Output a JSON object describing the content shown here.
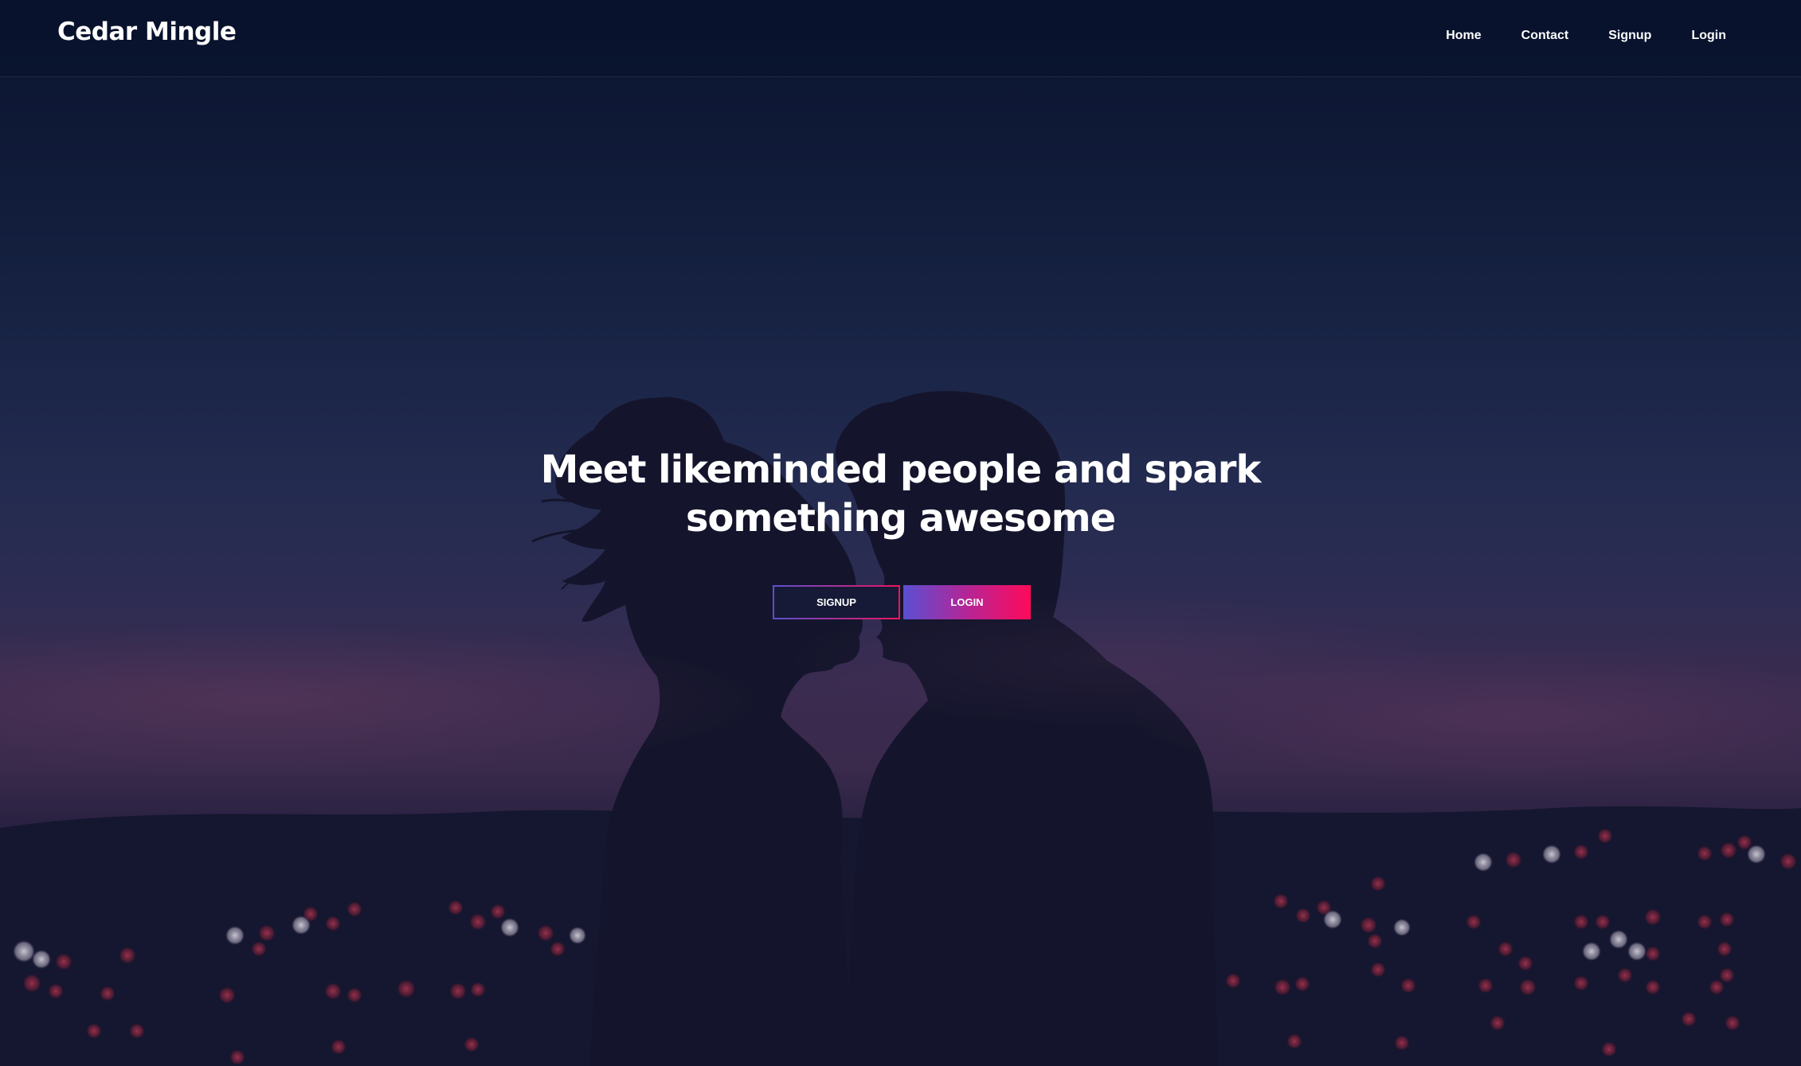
{
  "navbar": {
    "brand": "Cedar Mingle",
    "links": [
      {
        "label": "Home"
      },
      {
        "label": "Contact"
      },
      {
        "label": "Signup"
      },
      {
        "label": "Login"
      }
    ]
  },
  "hero": {
    "headline_line1": "Meet likeminded people and spark",
    "headline_line2": "something awesome",
    "signup_button": "SIGNUP",
    "login_button": "LOGIN"
  },
  "colors": {
    "background_top": "#0a1430",
    "background_mid": "#2c2c52",
    "accent_start": "#5a4fd3",
    "accent_end": "#ff0a5a",
    "text": "#ffffff"
  }
}
